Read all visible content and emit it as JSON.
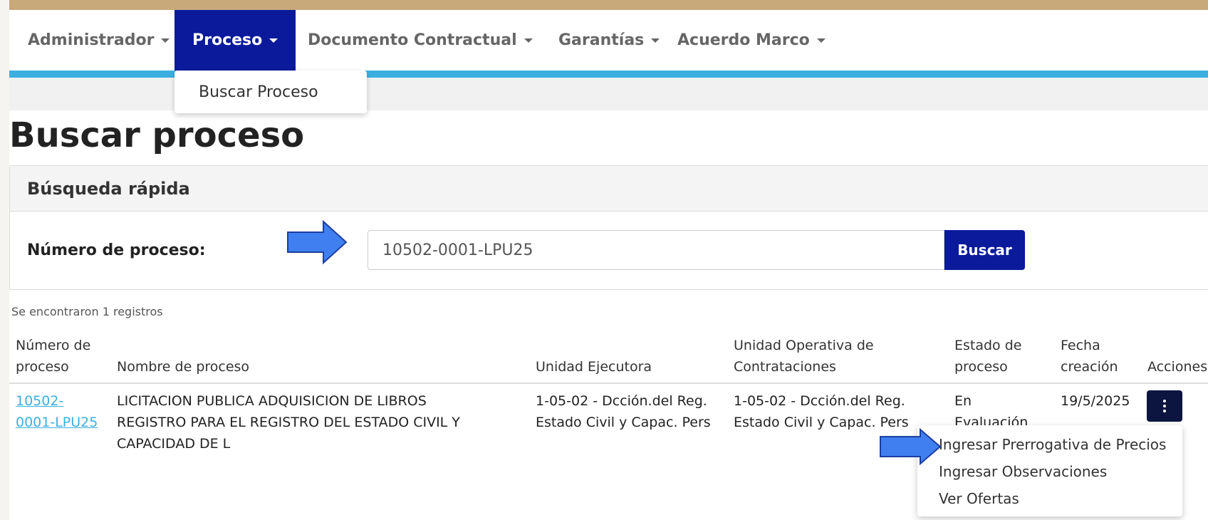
{
  "nav": {
    "items": [
      {
        "label": "Administrador"
      },
      {
        "label": "Proceso"
      },
      {
        "label": "Documento Contractual"
      },
      {
        "label": "Garantías"
      },
      {
        "label": "Acuerdo Marco"
      }
    ],
    "dropdown_item": "Buscar Proceso"
  },
  "page": {
    "title": "Buscar proceso"
  },
  "quick_search": {
    "header": "Búsqueda rápida",
    "field_label": "Número de proceso:",
    "input_value": "10502-0001-LPU25",
    "button_label": "Buscar"
  },
  "results": {
    "count_text": "Se encontraron 1 registros",
    "headers": {
      "numero_line1": "Número de",
      "numero_line2": "proceso",
      "nombre": "Nombre de proceso",
      "unidad_ejecutora": "Unidad Ejecutora",
      "uoc_line1": "Unidad Operativa de",
      "uoc_line2": "Contrataciones",
      "estado_line1": "Estado de",
      "estado_line2": "proceso",
      "fecha_line1": "Fecha",
      "fecha_line2": "creación",
      "acciones": "Acciones"
    },
    "rows": [
      {
        "numero_line1": "10502-",
        "numero_line2": "0001-LPU25",
        "nombre_line1": "LICITACION PUBLICA ADQUISICION DE LIBROS",
        "nombre_line2": "REGISTRO PARA EL REGISTRO DEL ESTADO CIVIL Y",
        "nombre_line3": "CAPACIDAD DE L",
        "unidad_ejecutora_line1": "1-05-02 - Dcción.del Reg.",
        "unidad_ejecutora_line2": "Estado Civil y Capac. Pers",
        "uoc_line1": "1-05-02 - Dcción.del Reg.",
        "uoc_line2": "Estado Civil y Capac. Pers",
        "estado_line1": "En",
        "estado_line2": "Evaluación",
        "fecha": "19/5/2025"
      }
    ]
  },
  "actions_menu": {
    "items": [
      {
        "label": "Ingresar Prerrogativa de Precios"
      },
      {
        "label": "Ingresar Observaciones"
      },
      {
        "label": "Ver Ofertas"
      }
    ]
  },
  "colors": {
    "nav_active": "#0a1a9b",
    "accent_bar": "#3bb0e0",
    "top_strip": "#c8a97a",
    "annotation_arrow": "#3f7fef",
    "action_button": "#0b1540"
  }
}
